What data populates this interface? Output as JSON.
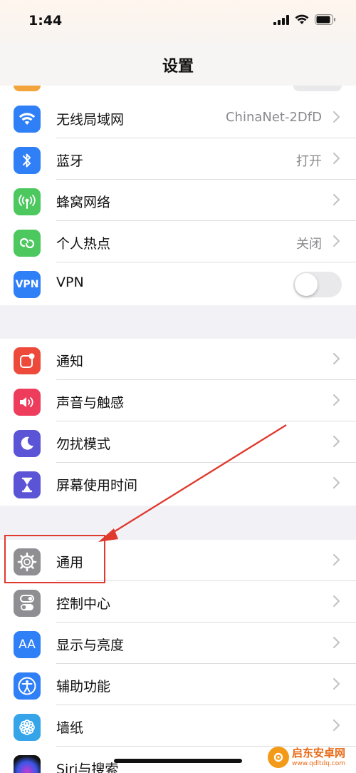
{
  "status_bar": {
    "time": "1:44"
  },
  "nav": {
    "title": "设置"
  },
  "group1": [
    {
      "label": "无线局域网",
      "value": "ChinaNet-2DfD",
      "icon": "wifi-icon",
      "color": "#2f7ff6"
    },
    {
      "label": "蓝牙",
      "value": "打开",
      "icon": "bluetooth-icon",
      "color": "#2f7ff6"
    },
    {
      "label": "蜂窝网络",
      "value": "",
      "icon": "cellular-icon",
      "color": "#4cc85f"
    },
    {
      "label": "个人热点",
      "value": "关闭",
      "icon": "hotspot-icon",
      "color": "#4cc85f"
    },
    {
      "label": "VPN",
      "value": "",
      "icon": "vpn-icon",
      "color": "#2f7ff6",
      "icon_text": "VPN",
      "toggle": false
    }
  ],
  "group2": [
    {
      "label": "通知",
      "icon": "notifications-icon",
      "color": "#ee4a3c"
    },
    {
      "label": "声音与触感",
      "icon": "sound-icon",
      "color": "#ee3c5c"
    },
    {
      "label": "勿扰模式",
      "icon": "moon-icon",
      "color": "#5b54d6"
    },
    {
      "label": "屏幕使用时间",
      "icon": "hourglass-icon",
      "color": "#5b54d6"
    }
  ],
  "group3": [
    {
      "label": "通用",
      "icon": "gear-icon",
      "color": "#8e8e93"
    },
    {
      "label": "控制中心",
      "icon": "control-center-icon",
      "color": "#8e8e93"
    },
    {
      "label": "显示与亮度",
      "icon": "display-icon",
      "color": "#2f7ff6",
      "icon_text": "AA"
    },
    {
      "label": "辅助功能",
      "icon": "accessibility-icon",
      "color": "#2f7ff6"
    },
    {
      "label": "墙纸",
      "icon": "wallpaper-icon",
      "color": "#35a4e8"
    },
    {
      "label": "Siri与搜索",
      "icon": "siri-icon",
      "color": "#222222"
    }
  ],
  "watermark": {
    "title": "启东安卓网",
    "url": "www.qdltdq.com"
  },
  "colors": {
    "annotation": "#e03a2f",
    "chevron": "#c4c4c7",
    "value_gray": "#8a8a8e"
  }
}
